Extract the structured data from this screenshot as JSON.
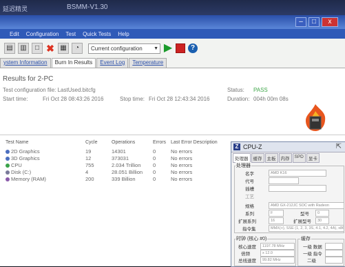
{
  "outer": {
    "app_name": "延迟精灵",
    "tool_name": "BSMM-V1.30"
  },
  "window": {
    "controls": {
      "minimize": "–",
      "restore": "□",
      "close": "x"
    }
  },
  "menubar": [
    "Edit",
    "Configuration",
    "Test",
    "Quick Tests",
    "Help"
  ],
  "toolbar": {
    "config_select": "Current configuration",
    "icons": [
      "new-icon",
      "open-icon",
      "save-icon",
      "delete-icon",
      "report-icon",
      "gauge-icon",
      "play-icon",
      "stop-icon",
      "help-icon"
    ]
  },
  "tabs": [
    "ystem Information",
    "Burn In Results",
    "Event Log",
    "Temperature"
  ],
  "results": {
    "title": "Results for 2-PC",
    "config_line": "Test configuration file:   LastUsed.bitcfg",
    "start_label": "Start time:",
    "start_value": "Fri Oct 28 08:43:26 2016",
    "stop_label": "Stop time:",
    "stop_value": "Fri Oct 28 12:43:34 2016",
    "status_label": "Status:",
    "status_value": "PASS",
    "duration_label": "Duration:",
    "duration_value": "004h 00m 08s"
  },
  "table": {
    "headers": [
      "Test Name",
      "Cycle",
      "Operations",
      "Errors",
      "Last Error Description"
    ],
    "rows": [
      {
        "name": "2D Graphics",
        "cycle": "19",
        "ops": "14301",
        "errors": "0",
        "desc": "No errors",
        "dot": "#4c6fbf"
      },
      {
        "name": "3D Graphics",
        "cycle": "12",
        "ops": "373031",
        "errors": "0",
        "desc": "No errors",
        "dot": "#4c6fbf"
      },
      {
        "name": "CPU",
        "cycle": "755",
        "ops": "2.034 Trillion",
        "errors": "0",
        "desc": "No errors",
        "dot": "#3aa34a"
      },
      {
        "name": "Disk (C:)",
        "cycle": "4",
        "ops": "28.051 Billion",
        "errors": "0",
        "desc": "No errors",
        "dot": "#7a7a9a"
      },
      {
        "name": "Memory (RAM)",
        "cycle": "200",
        "ops": "339 Billion",
        "errors": "0",
        "desc": "No errors",
        "dot": "#8a5aaa"
      }
    ]
  },
  "cpuz": {
    "title": "CPU-Z",
    "tabs": [
      "处理器",
      "缓存",
      "主板",
      "内存",
      "SPD",
      "显卡"
    ],
    "processor_group": "处理器",
    "fields": {
      "name_label": "名字",
      "name_value": "AMD K16",
      "codename_label": "代号",
      "socket_label": "插槽",
      "process_label": "工艺",
      "spec_label": "规格",
      "spec_value": "AMD GX-212JC SOC with Radeon",
      "family_label": "系列",
      "family_value": "F",
      "model_label": "型号",
      "model_value": "0",
      "ext_family_label": "扩展系列",
      "ext_family_value": "16",
      "ext_model_label": "扩展型号",
      "ext_model_value": "30",
      "instr_label": "指令集",
      "instr_value": "MMX(+), SSE (1, 2, 3, 3S, 4.1, 4.2, 4A), x86"
    },
    "clocks_group": "时钟 (核心 #0)",
    "cache_group": "缓存",
    "clocks": {
      "core_speed_label": "核心速度",
      "core_speed_value": "1197.78 MHz",
      "multiplier_label": "倍频",
      "multiplier_value": "x 12.0",
      "bus_label": "总线速度",
      "bus_value": "99.82 MHz"
    },
    "cache": {
      "l1d_label": "一级 数据",
      "l1i_label": "一级 指令",
      "l2_label": "二级"
    }
  }
}
